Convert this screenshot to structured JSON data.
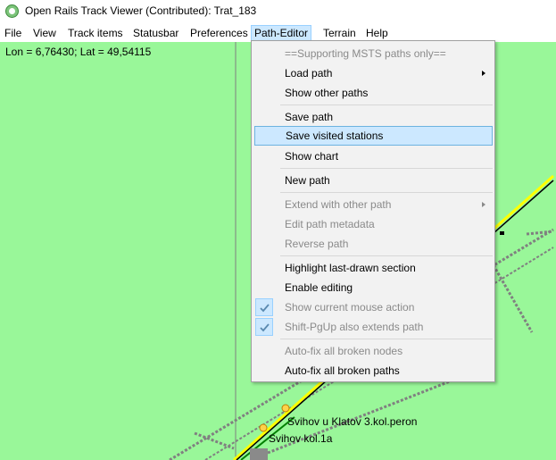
{
  "window": {
    "title": "Open Rails Track Viewer (Contributed): Trat_183",
    "icon": "app-logo-icon"
  },
  "menubar": {
    "items": [
      {
        "label": "File"
      },
      {
        "label": "View"
      },
      {
        "label": "Track items"
      },
      {
        "label": "Statusbar"
      },
      {
        "label": "Preferences"
      },
      {
        "label": "Path-Editor",
        "active": true
      },
      {
        "label": "Terrain"
      },
      {
        "label": "Help"
      }
    ]
  },
  "map": {
    "coords": "Lon = 6,76430; Lat = 49,54115",
    "background": "#99f799",
    "stations": [
      {
        "label": "Svihov u Klatov 3.kol.peron"
      },
      {
        "label": "Svihov kol.1a"
      }
    ]
  },
  "path_editor_menu": {
    "items": [
      {
        "label": "==Supporting MSTS paths only==",
        "disabled": true
      },
      {
        "label": "Load path",
        "submenu": true
      },
      {
        "label": "Show other paths"
      },
      {
        "label": "Save path"
      },
      {
        "label": "Save visited stations",
        "highlighted": true
      },
      {
        "label": "Show chart"
      },
      {
        "label": "New path"
      },
      {
        "label": "Extend with other path",
        "disabled": true,
        "submenu": true
      },
      {
        "label": "Edit path metadata",
        "disabled": true
      },
      {
        "label": "Reverse path",
        "disabled": true
      },
      {
        "label": "Highlight last-drawn section"
      },
      {
        "label": "Enable editing"
      },
      {
        "label": "Show current mouse action",
        "disabled": true,
        "checked": true
      },
      {
        "label": "Shift-PgUp also extends path",
        "disabled": true,
        "checked": true
      },
      {
        "label": "Auto-fix all broken nodes",
        "disabled": true
      },
      {
        "label": "Auto-fix all broken paths"
      }
    ]
  },
  "colors": {
    "accent": "#cce8ff",
    "accent_border": "#99d1ff",
    "track_yellow": "#ffff00",
    "track_grey": "#808080"
  }
}
